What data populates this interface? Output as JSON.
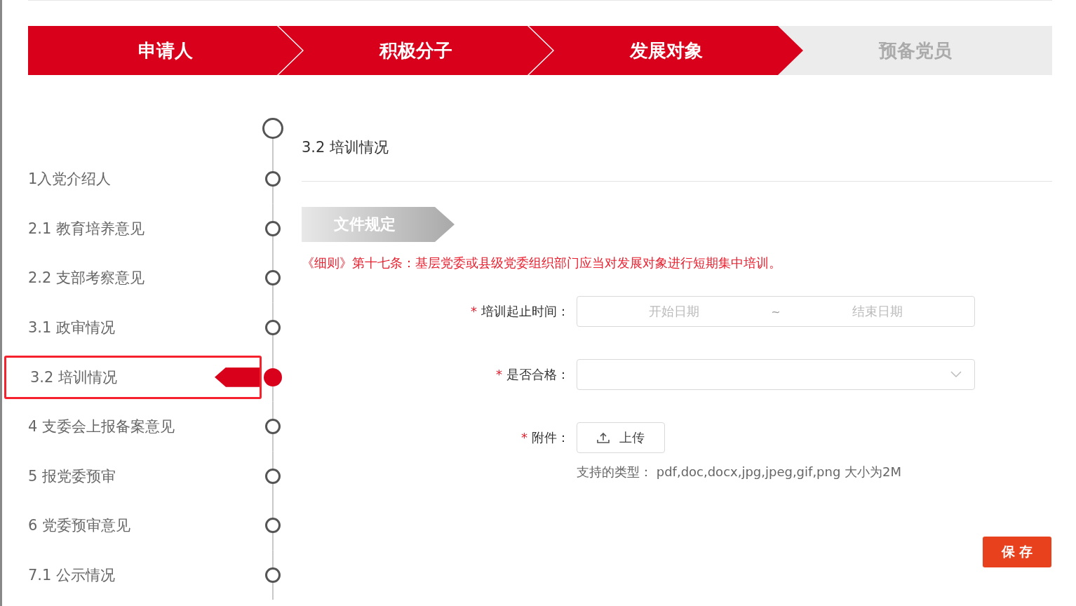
{
  "steps": [
    {
      "label": "申请人",
      "done": true
    },
    {
      "label": "积极分子",
      "done": true
    },
    {
      "label": "发展对象",
      "done": true
    },
    {
      "label": "预备党员",
      "done": false
    }
  ],
  "timeline": [
    {
      "label": "1入党介绍人",
      "selected": false
    },
    {
      "label": "2.1 教育培养意见",
      "selected": false
    },
    {
      "label": "2.2 支部考察意见",
      "selected": false
    },
    {
      "label": "3.1 政审情况",
      "selected": false
    },
    {
      "label": "3.2 培训情况",
      "selected": true
    },
    {
      "label": "4 支委会上报备案意见",
      "selected": false
    },
    {
      "label": "5 报党委预审",
      "selected": false
    },
    {
      "label": "6 党委预审意见",
      "selected": false
    },
    {
      "label": "7.1 公示情况",
      "selected": false
    }
  ],
  "section": {
    "title": "3.2 培训情况",
    "tag": "文件规定",
    "rule": "《细则》第十七条：基层党委或县级党委组织部门应当对发展对象进行短期集中培训。"
  },
  "form": [
    {
      "kind": "date-range",
      "label": "培训起止时间：",
      "required_mark": "*",
      "start_placeholder": "开始日期",
      "separator": "~",
      "end_placeholder": "结束日期"
    },
    {
      "kind": "select",
      "label": "是否合格：",
      "required_mark": "*"
    },
    {
      "kind": "upload",
      "label": "附件：",
      "required_mark": "*",
      "button": "上传",
      "hint": "支持的类型：  pdf,doc,docx,jpg,jpeg,gif,png 大小为2M"
    }
  ],
  "save": "保 存"
}
